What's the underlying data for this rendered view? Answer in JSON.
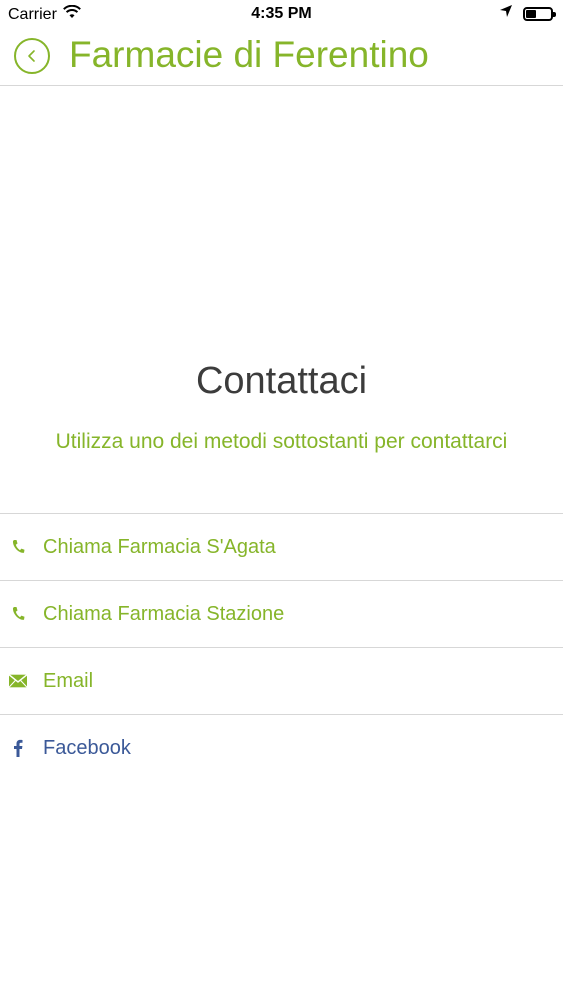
{
  "status_bar": {
    "carrier": "Carrier",
    "time": "4:35 PM",
    "battery_level": 0.4
  },
  "nav": {
    "title": "Farmacie di Ferentino",
    "back_icon": "chevron-left-icon"
  },
  "content": {
    "heading": "Contattaci",
    "subheading": "Utilizza uno dei metodi sottostanti per contattarci"
  },
  "contacts": [
    {
      "label": "Chiama Farmacia S'Agata",
      "icon": "phone-icon"
    },
    {
      "label": "Chiama Farmacia Stazione",
      "icon": "phone-icon"
    },
    {
      "label": "Email",
      "icon": "mail-icon"
    },
    {
      "label": "Facebook",
      "icon": "facebook-icon"
    }
  ],
  "colors": {
    "accent": "#86b52a",
    "facebook": "#3b5998",
    "heading": "#3c3c3c",
    "divider": "#d7d7d7"
  }
}
